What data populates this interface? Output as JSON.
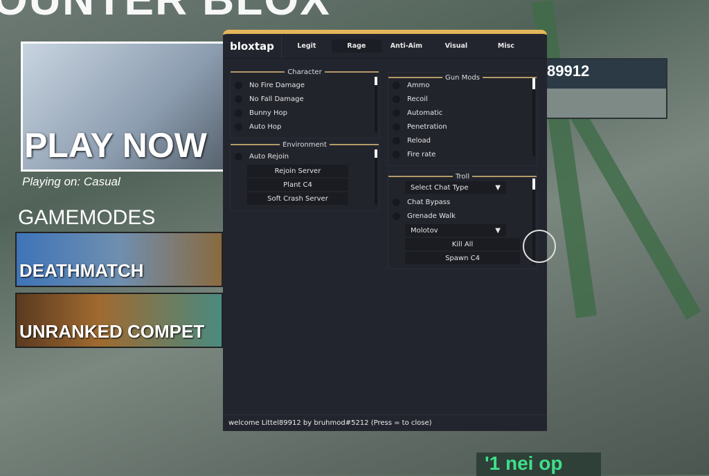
{
  "background": {
    "title": "OUNTER BLOX",
    "play": "PLAY NOW",
    "playing_on": "Playing on: Casual",
    "gamemodes": "GAMEMODES",
    "modes": [
      "DEATHMATCH",
      "UNRANKED COMPET"
    ],
    "player_panel": "89912",
    "bottom_text": "'1 nei op"
  },
  "menu": {
    "logo": "bloxtap",
    "tabs": [
      {
        "label": "Legit"
      },
      {
        "label": "Rage",
        "selected": true
      },
      {
        "label": "Anti-Aim"
      },
      {
        "label": "Visual"
      },
      {
        "label": "Misc"
      }
    ],
    "character": {
      "title": "Character",
      "toggles": [
        "No Fire Damage",
        "No Fall Damage",
        "Bunny Hop",
        "Auto Hop"
      ]
    },
    "environment": {
      "title": "Environment",
      "toggles": [
        "Auto Rejoin"
      ],
      "buttons": [
        "Rejoin Server",
        "Plant C4",
        "Soft Crash Server"
      ]
    },
    "gun_mods": {
      "title": "Gun Mods",
      "toggles": [
        "Ammo",
        "Recoil",
        "Automatic",
        "Penetration",
        "Reload",
        "Fire rate"
      ]
    },
    "troll": {
      "title": "Troll",
      "chat_type": "Select Chat Type",
      "chat_bypass": "Chat Bypass",
      "grenade_walk": "Grenade Walk",
      "grenade": "Molotov",
      "kill_all": "Kill All",
      "spawn_c4": "Spawn C4"
    },
    "footer": "welcome Littel89912 by bruhmod#5212 (Press = to close)"
  },
  "colors": {
    "accent": "#e4b65a",
    "panel": "#23252e",
    "divider": "#b39a68"
  }
}
